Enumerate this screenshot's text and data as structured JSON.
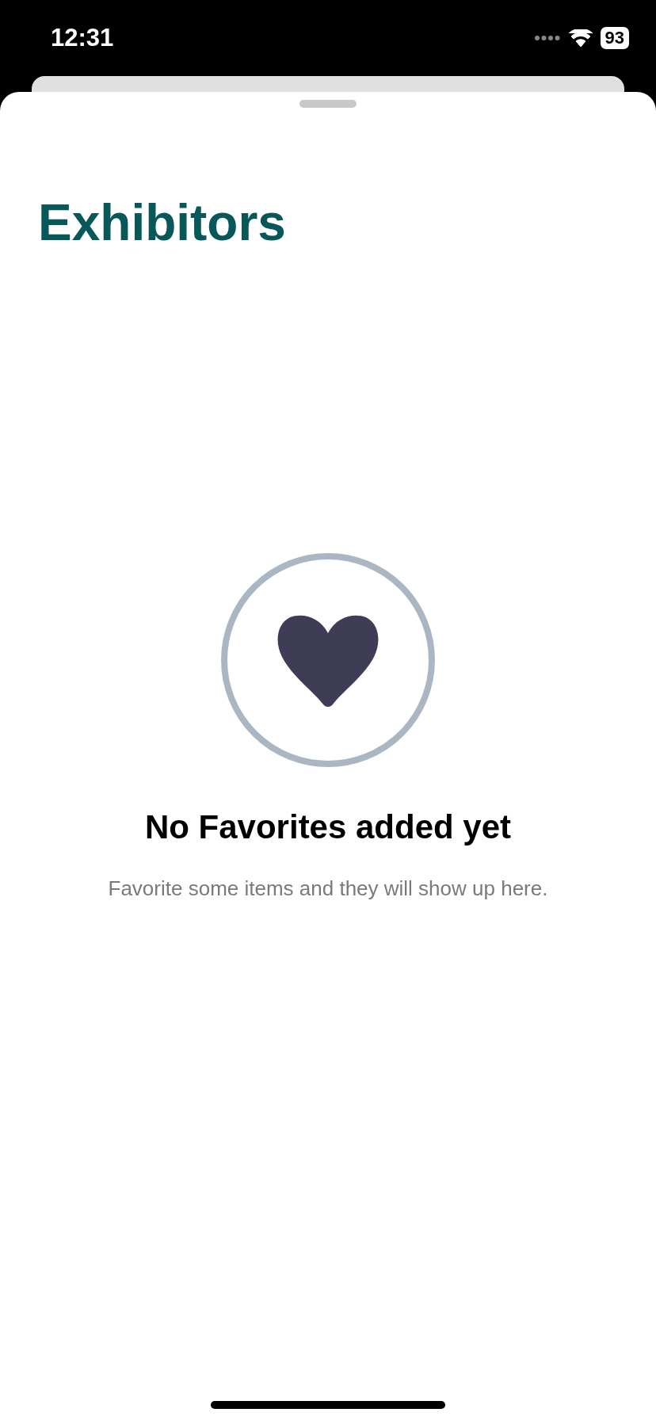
{
  "status_bar": {
    "time": "12:31",
    "battery": "93"
  },
  "title": "Exhibitors",
  "empty_state": {
    "heading": "No Favorites added yet",
    "message": "Favorite some items and they will show up here."
  }
}
